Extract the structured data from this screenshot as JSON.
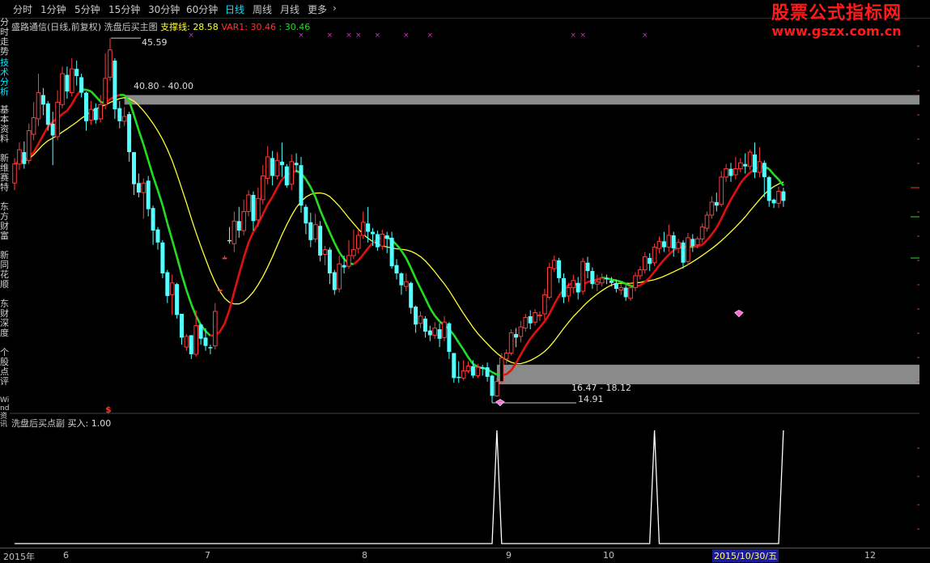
{
  "toolbar": {
    "timeframes": [
      "分时",
      "1分钟",
      "5分钟",
      "15分钟",
      "30分钟",
      "60分钟",
      "日线",
      "周线",
      "月线",
      "更多"
    ],
    "more_arrow": "›",
    "active": "日线"
  },
  "watermark": {
    "line1": "股票公式指标网",
    "line2": "www.gszx.com.cn"
  },
  "sidebar": {
    "items": [
      "分时走势",
      "技术分析",
      "基本资料",
      "新维赛特",
      "东方财富",
      "新同花顺",
      "东财深度",
      "个股点评",
      "Wind资讯"
    ],
    "active": "技术分析"
  },
  "main_panel": {
    "stock": "盛路通信(日线,前复权)",
    "indicator": "洗盘后买主图",
    "support_label": "支撑线:",
    "support_value": "28.58",
    "var1_label": "VAR1:",
    "var1_value": "30.46",
    "var1_value2": ": 30.46",
    "high_label": "45.59",
    "resistance_label": "40.80 - 40.00",
    "support_zone_label": "16.47 - 18.12",
    "low_label": "14.91",
    "dollar_marker": "$"
  },
  "sub_panel": {
    "title": "洗盘后买点副",
    "buy_label": "买入:",
    "buy_value": "1.00"
  },
  "date_axis": {
    "year": "2015年",
    "months": [
      "6",
      "7",
      "8",
      "9",
      "10",
      "12"
    ],
    "cursor_date": "2015/10/30/五"
  },
  "colors": {
    "up": "#ff3b3b",
    "down": "#54ffff",
    "ma_up": "#e01010",
    "ma_down": "#22dd22",
    "slow_ma": "#ffff33",
    "zone": "#8a8a8a",
    "buy_line": "#ffffff",
    "cross": "#cc33cc"
  },
  "chart_data": {
    "type": "candlestick",
    "candles": [
      [
        33.4,
        35.0,
        32.8,
        35.5
      ],
      [
        35.0,
        36.2,
        34.5,
        36.8
      ],
      [
        36.0,
        35.0,
        34.6,
        36.9
      ],
      [
        35.3,
        37.8,
        35.0,
        38.4
      ],
      [
        37.5,
        38.9,
        37.0,
        40.2
      ],
      [
        38.8,
        41.0,
        38.2,
        42.6
      ],
      [
        40.8,
        40.0,
        39.1,
        41.4
      ],
      [
        40.1,
        38.3,
        37.8,
        40.3
      ],
      [
        38.4,
        37.4,
        34.9,
        39.4
      ],
      [
        37.3,
        40.2,
        37.0,
        41.2
      ],
      [
        40.0,
        42.6,
        39.7,
        43.2
      ],
      [
        42.5,
        41.1,
        40.5,
        43.2
      ],
      [
        41.0,
        43.0,
        40.7,
        43.9
      ],
      [
        43.0,
        42.4,
        41.6,
        43.7
      ],
      [
        42.3,
        41.0,
        40.6,
        42.6
      ],
      [
        41.0,
        38.6,
        37.8,
        41.1
      ],
      [
        38.7,
        39.6,
        38.3,
        40.3
      ],
      [
        39.7,
        38.7,
        38.4,
        40.1
      ],
      [
        38.8,
        40.0,
        38.5,
        40.8
      ],
      [
        40.0,
        42.2,
        39.6,
        44.3
      ],
      [
        42.3,
        44.6,
        42.0,
        45.59
      ],
      [
        43.7,
        39.6,
        38.8,
        43.9
      ],
      [
        39.7,
        38.6,
        38.0,
        40.3
      ],
      [
        38.6,
        39.0,
        38.2,
        39.8
      ],
      [
        39.2,
        36.0,
        35.2,
        39.4
      ],
      [
        36.0,
        33.3,
        32.4,
        36.0
      ],
      [
        33.4,
        32.6,
        32.2,
        34.2
      ],
      [
        32.6,
        33.4,
        30.4,
        33.8
      ],
      [
        33.6,
        31.2,
        30.6,
        34.0
      ],
      [
        31.3,
        29.4,
        28.2,
        31.5
      ],
      [
        29.5,
        28.4,
        27.8,
        29.7
      ],
      [
        28.4,
        25.8,
        25.4,
        28.6
      ],
      [
        25.9,
        23.9,
        23.3,
        26.1
      ],
      [
        24.0,
        25.0,
        22.3,
        25.7
      ],
      [
        24.9,
        22.3,
        22.0,
        25.0
      ],
      [
        22.4,
        20.4,
        19.8,
        22.4
      ],
      [
        19.6,
        20.5,
        19.3,
        20.7
      ],
      [
        20.6,
        19.0,
        18.6,
        20.6
      ],
      [
        19.0,
        21.4,
        18.8,
        22.7
      ],
      [
        21.5,
        20.3,
        19.8,
        21.6
      ],
      [
        20.4,
        19.7,
        19.3,
        21.2
      ],
      [
        19.6,
        19.5,
        19.0,
        19.8
      ],
      [
        19.7,
        22.6,
        19.4,
        23.3
      ],
      [
        24.4,
        24.4,
        24.2,
        24.5
      ],
      [
        27.1,
        27.1,
        27.0,
        27.3
      ],
      [
        28.6,
        28.5,
        28.3,
        29.7
      ],
      [
        28.3,
        30.2,
        27.6,
        31.0
      ],
      [
        30.2,
        29.4,
        28.8,
        31.4
      ],
      [
        29.4,
        31.0,
        29.0,
        32.0
      ],
      [
        31.0,
        32.4,
        30.6,
        32.8
      ],
      [
        32.4,
        30.2,
        29.4,
        32.7
      ],
      [
        30.3,
        32.1,
        29.7,
        33.0
      ],
      [
        32.0,
        34.0,
        31.6,
        34.9
      ],
      [
        33.8,
        35.6,
        33.3,
        36.5
      ],
      [
        35.5,
        34.0,
        33.2,
        36.1
      ],
      [
        34.0,
        35.3,
        33.7,
        36.0
      ],
      [
        35.2,
        34.9,
        33.9,
        36.8
      ],
      [
        34.8,
        33.2,
        33.0,
        35.0
      ],
      [
        33.3,
        35.2,
        32.8,
        35.8
      ],
      [
        35.1,
        34.9,
        34.3,
        35.9
      ],
      [
        34.9,
        31.5,
        30.9,
        35.6
      ],
      [
        31.4,
        30.0,
        29.1,
        31.6
      ],
      [
        30.1,
        28.6,
        28.0,
        30.9
      ],
      [
        28.7,
        29.9,
        28.4,
        30.8
      ],
      [
        29.8,
        27.3,
        26.8,
        30.2
      ],
      [
        27.4,
        27.8,
        26.5,
        28.1
      ],
      [
        27.8,
        25.8,
        24.9,
        28.0
      ],
      [
        25.9,
        24.4,
        24.0,
        26.1
      ],
      [
        24.5,
        26.6,
        24.2,
        27.3
      ],
      [
        26.5,
        26.3,
        25.8,
        27.3
      ],
      [
        26.4,
        27.3,
        26.2,
        28.6
      ],
      [
        27.3,
        27.8,
        27.0,
        29.5
      ],
      [
        27.9,
        29.0,
        27.5,
        29.5
      ],
      [
        29.0,
        30.1,
        28.7,
        31.0
      ],
      [
        30.0,
        29.3,
        28.4,
        31.4
      ],
      [
        29.3,
        29.1,
        28.1,
        29.6
      ],
      [
        29.1,
        28.0,
        27.7,
        29.4
      ],
      [
        28.1,
        29.1,
        27.8,
        29.5
      ],
      [
        29.0,
        28.7,
        27.5,
        29.3
      ],
      [
        28.8,
        26.4,
        26.2,
        29.3
      ],
      [
        26.5,
        25.8,
        25.3,
        27.0
      ],
      [
        25.8,
        24.8,
        24.0,
        25.9
      ],
      [
        24.7,
        25.1,
        24.3,
        25.8
      ],
      [
        25.0,
        22.9,
        22.4,
        25.1
      ],
      [
        23.0,
        21.5,
        20.8,
        23.1
      ],
      [
        21.6,
        22.2,
        21.2,
        22.6
      ],
      [
        22.0,
        20.9,
        20.4,
        22.2
      ],
      [
        21.0,
        20.6,
        20.1,
        21.4
      ],
      [
        20.6,
        21.2,
        20.3,
        21.7
      ],
      [
        21.1,
        20.3,
        19.6,
        21.6
      ],
      [
        20.4,
        21.7,
        20.1,
        22.2
      ],
      [
        21.6,
        19.2,
        18.6,
        21.7
      ],
      [
        19.1,
        17.0,
        16.6,
        19.1
      ],
      [
        17.1,
        17.0,
        16.6,
        18.4
      ],
      [
        17.0,
        17.6,
        16.8,
        18.5
      ],
      [
        17.6,
        18.0,
        17.4,
        18.4
      ],
      [
        18.0,
        17.2,
        17.0,
        18.5
      ],
      [
        17.2,
        17.9,
        17.0,
        18.2
      ],
      [
        17.9,
        17.8,
        17.2,
        18.1
      ],
      [
        17.9,
        17.1,
        16.7,
        18.3
      ],
      [
        17.2,
        15.5,
        14.91,
        17.3
      ],
      [
        15.5,
        16.7,
        15.4,
        17.0
      ],
      [
        16.7,
        18.7,
        16.5,
        19.1
      ],
      [
        18.6,
        19.1,
        18.2,
        19.4
      ],
      [
        19.1,
        20.8,
        18.9,
        21.1
      ],
      [
        20.7,
        20.4,
        19.6,
        21.2
      ],
      [
        20.5,
        21.3,
        20.0,
        21.8
      ],
      [
        21.2,
        22.1,
        20.9,
        22.4
      ],
      [
        22.2,
        21.6,
        21.1,
        22.7
      ],
      [
        21.7,
        22.5,
        21.4,
        22.8
      ],
      [
        22.3,
        22.3,
        21.8,
        22.6
      ],
      [
        22.4,
        24.0,
        21.9,
        24.5
      ],
      [
        23.8,
        26.3,
        23.6,
        26.7
      ],
      [
        26.2,
        26.9,
        25.9,
        27.3
      ],
      [
        26.9,
        25.4,
        25.0,
        27.1
      ],
      [
        25.4,
        23.8,
        23.3,
        25.8
      ],
      [
        23.9,
        24.6,
        23.4,
        25.0
      ],
      [
        24.6,
        25.2,
        24.1,
        25.7
      ],
      [
        25.0,
        24.2,
        23.6,
        25.5
      ],
      [
        24.3,
        26.8,
        24.0,
        27.1
      ],
      [
        26.7,
        26.0,
        25.4,
        27.2
      ],
      [
        26.0,
        24.9,
        24.5,
        26.3
      ],
      [
        24.9,
        25.1,
        24.3,
        25.7
      ],
      [
        25.0,
        25.4,
        24.7,
        25.8
      ],
      [
        25.4,
        25.3,
        24.9,
        25.7
      ],
      [
        25.2,
        25.0,
        24.7,
        25.5
      ],
      [
        25.0,
        24.5,
        24.2,
        25.3
      ],
      [
        24.4,
        24.6,
        24.0,
        24.9
      ],
      [
        24.6,
        23.8,
        23.5,
        24.8
      ],
      [
        23.7,
        24.6,
        23.5,
        25.0
      ],
      [
        24.6,
        25.6,
        24.3,
        25.9
      ],
      [
        25.6,
        26.1,
        25.3,
        26.4
      ],
      [
        26.1,
        27.2,
        25.8,
        27.6
      ],
      [
        27.1,
        26.6,
        26.0,
        27.5
      ],
      [
        26.7,
        28.0,
        26.4,
        28.3
      ],
      [
        27.9,
        28.5,
        27.5,
        28.9
      ],
      [
        28.5,
        28.0,
        27.6,
        29.3
      ],
      [
        28.0,
        29.0,
        27.6,
        29.9
      ],
      [
        29.0,
        27.9,
        27.2,
        29.3
      ],
      [
        27.9,
        28.4,
        27.5,
        28.7
      ],
      [
        28.4,
        26.7,
        26.2,
        28.6
      ],
      [
        26.8,
        28.8,
        26.5,
        29.2
      ],
      [
        28.7,
        28.1,
        27.6,
        29.1
      ],
      [
        28.2,
        28.7,
        27.9,
        28.9
      ],
      [
        28.7,
        29.7,
        28.4,
        30.0
      ],
      [
        29.6,
        30.7,
        29.3,
        31.0
      ],
      [
        30.7,
        31.8,
        30.4,
        32.3
      ],
      [
        31.8,
        31.5,
        31.0,
        32.6
      ],
      [
        31.6,
        33.9,
        31.4,
        34.4
      ],
      [
        33.9,
        34.6,
        33.5,
        35.0
      ],
      [
        34.6,
        34.0,
        33.5,
        35.1
      ],
      [
        34.1,
        34.6,
        33.7,
        35.6
      ],
      [
        34.6,
        35.1,
        34.3,
        35.5
      ],
      [
        35.0,
        34.8,
        34.2,
        35.9
      ],
      [
        34.8,
        36.0,
        34.5,
        36.2
      ],
      [
        35.8,
        34.3,
        33.8,
        36.8
      ],
      [
        34.3,
        35.2,
        33.9,
        36.4
      ],
      [
        35.1,
        33.9,
        32.2,
        35.3
      ],
      [
        33.9,
        31.9,
        31.4,
        34.0
      ],
      [
        32.0,
        31.7,
        31.3,
        32.1
      ],
      [
        31.7,
        32.7,
        31.3,
        33.1
      ],
      [
        32.7,
        31.9,
        31.4,
        33.0
      ]
    ],
    "price_labels": [
      "45.59",
      "40.80 - 40.00",
      "16.47 - 18.12",
      "14.91"
    ],
    "zones": [
      [
        40.0,
        40.8
      ],
      [
        16.47,
        18.12
      ]
    ],
    "buy_signal_candles": [
      101,
      134,
      166
    ],
    "support_line": 28.58,
    "var1": 30.46,
    "ylim": [
      14.3,
      47.3
    ]
  }
}
